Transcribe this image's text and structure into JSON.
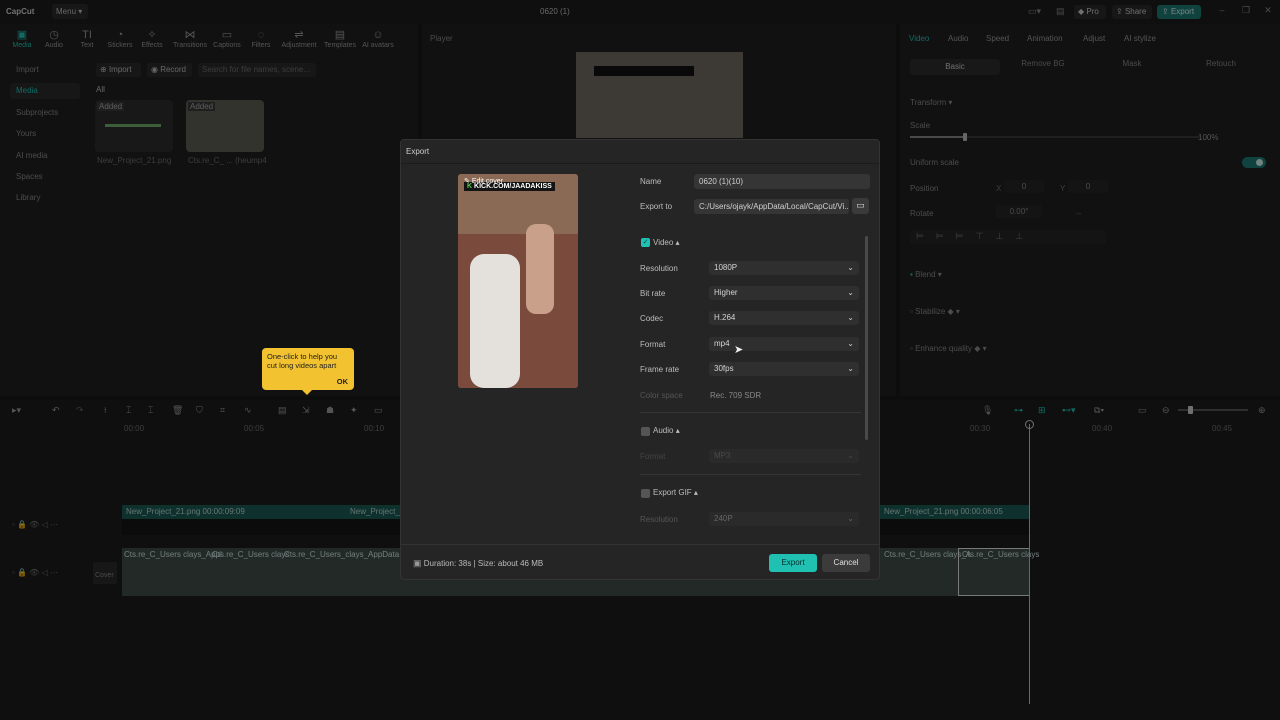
{
  "app": {
    "logo": "CapCut",
    "menu": "Menu",
    "window_title": "0620 (1)",
    "pro": "Pro",
    "share": "Share",
    "export": "Export"
  },
  "toolbar": {
    "tools": [
      "Media",
      "Audio",
      "Text",
      "Stickers",
      "Effects",
      "Transitions",
      "Captions",
      "Filters",
      "Adjustment",
      "Templates",
      "AI avatars"
    ]
  },
  "media_panel": {
    "sidebar": [
      "Import",
      "Media",
      "Subprojects",
      "Yours",
      "AI media",
      "Spaces",
      "Library"
    ],
    "import_btn": "Import",
    "record_btn": "Record",
    "search_placeholder": "Search for file names, scene...",
    "filter_all": "All",
    "items": [
      {
        "badge": "Added",
        "name": "New_Project_21.png"
      },
      {
        "badge": "Added",
        "name": "Cts.re_C_ ... (heump4"
      }
    ]
  },
  "player": {
    "title": "Player"
  },
  "props": {
    "tabs": [
      "Video",
      "Audio",
      "Speed",
      "Animation",
      "Adjust",
      "AI stylize"
    ],
    "subtabs": [
      "Basic",
      "Remove BG",
      "Mask",
      "Retouch"
    ],
    "transform": "Transform",
    "scale": "Scale",
    "scale_value": "100%",
    "uniform_scale": "Uniform scale",
    "position": "Position",
    "pos_x_label": "X",
    "pos_x": "0",
    "pos_y_label": "Y",
    "pos_y": "0",
    "rotate": "Rotate",
    "rotate_value": "0.00°",
    "rotate_extra": "--",
    "blend": "Blend",
    "stabilize": "Stabilize",
    "enhance_quality": "Enhance quality"
  },
  "timeline": {
    "ticks": [
      "00:00",
      "00:05",
      "00:10",
      "00:30",
      "00:40",
      "00:45"
    ],
    "clip1_name": "New_Project_21.png",
    "clip1_time": "00:00:09:09",
    "clip2_name": "New_Project_21",
    "clip3_name": "New_Project_21.png",
    "clip3_time": "00:00:06:05",
    "video_labels": [
      "Cts.re_C_Users clays_Appl",
      "Cts.re_C_Users clays",
      "Cts.re_C_Users_clays_AppData Local",
      "Cts.re_C_Users clays_A",
      "Cts.re_C_Users clays"
    ],
    "cover": "Cover"
  },
  "dialog": {
    "title": "Export",
    "preview_watermark": "KICK.COM/JAADAKISS",
    "preview_edit": "Edit cover",
    "name_label": "Name",
    "name_value": "0620 (1)(10)",
    "export_to_label": "Export to",
    "export_to_value": "C:/Users/ojayk/AppData/Local/CapCut/Vi...",
    "video_section": "Video",
    "resolution_label": "Resolution",
    "resolution_value": "1080P",
    "bitrate_label": "Bit rate",
    "bitrate_value": "Higher",
    "codec_label": "Codec",
    "codec_value": "H.264",
    "format_label": "Format",
    "format_value": "mp4",
    "framerate_label": "Frame rate",
    "framerate_value": "30fps",
    "colorspace_label": "Color space",
    "colorspace_value": "Rec. 709 SDR",
    "audio_section": "Audio",
    "audio_format_label": "Format",
    "audio_format_value": "MP3",
    "gif_section": "Export GIF",
    "gif_resolution_label": "Resolution",
    "gif_resolution_value": "240P",
    "footer_info": "Duration: 38s | Size: about 46 MB",
    "export_btn": "Export",
    "cancel_btn": "Cancel"
  },
  "tooltip": {
    "text": "One-click to help you cut long videos apart",
    "ok": "OK"
  },
  "colors": {
    "accent": "#20c0b3",
    "tooltip": "#f2c230",
    "track": "#1d5a55"
  }
}
